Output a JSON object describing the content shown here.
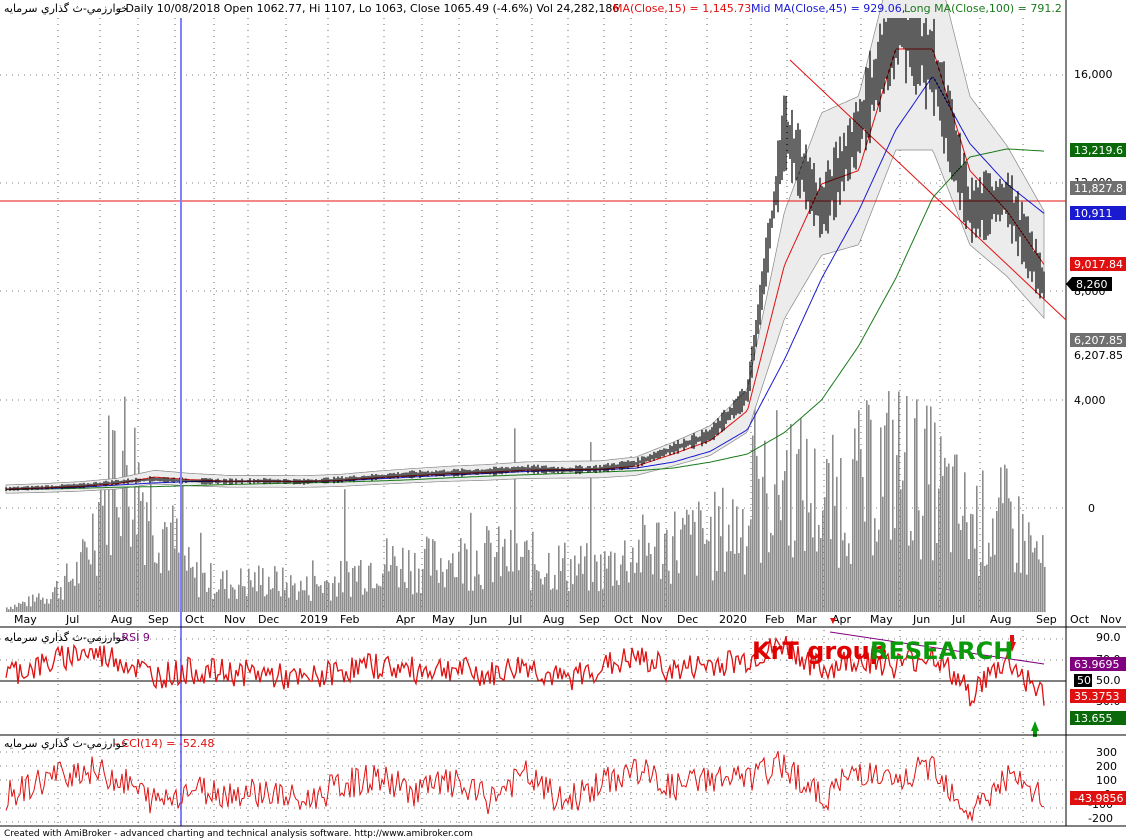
{
  "header": {
    "symbol": "خوارزمي-ث گذاري سرمايه",
    "info": " - Daily 10/08/2018 Open 1062.77, Hi 1107, Lo 1063, Close 1065.49 (-4.6%) Vol 24,282,186 ",
    "ma15": "MA(Close,15) = 1,145.73,",
    "ma45": " Mid MA(Close,45) = 929.06,",
    "ma100": " Long MA(Close,100) = 791.2"
  },
  "colors": {
    "price_bar": "#000000",
    "volume": "#8c8c8c",
    "ma15": "#e01010",
    "ma45": "#1a1ad0",
    "ma100": "#1a7a1a",
    "band_fill": "#ececec",
    "cursor": "#8080ff",
    "rsi": "#e01010",
    "cci": "#e01010",
    "trendline": "#e01010",
    "rsi_trend": "#800080"
  },
  "price_axis": {
    "ticks": [
      "16,000",
      "12,000",
      "8,000",
      "4,000",
      "0"
    ],
    "labels": [
      {
        "text": "13,219.6",
        "bg": "#0a6a0a",
        "fg": "#ffffff"
      },
      {
        "text": "11,827.8",
        "bg": "#707070",
        "fg": "#ffffff"
      },
      {
        "text": "10,911",
        "bg": "#1a1ad0",
        "fg": "#ffffff"
      },
      {
        "text": "9,017.84",
        "bg": "#e01010",
        "fg": "#ffffff"
      },
      {
        "text": "8,260",
        "bg": "#000000",
        "fg": "#ffffff"
      },
      {
        "text": "6,207.85",
        "bg": "#707070",
        "fg": "#ffffff"
      },
      {
        "text": "6,207.85",
        "bg": "#ffffff",
        "fg": "#000000"
      }
    ]
  },
  "x_axis": {
    "labels": [
      "May",
      "Jul",
      "Aug",
      "Sep",
      "Oct",
      "Nov",
      "Dec",
      "2019",
      "Feb",
      "Apr",
      "May",
      "Jun",
      "Jul",
      "Aug",
      "Sep",
      "Oct",
      "Nov",
      "Dec",
      "2020",
      "Feb",
      "Mar",
      "Apr",
      "May",
      "Jun",
      "Jul",
      "Aug",
      "Sep",
      "Oct",
      "Nov"
    ]
  },
  "rsi_panel": {
    "title_symbol": "خوارزمي-ث گذاري سرمايه",
    "title_ind": " - RSI 9",
    "ticks": [
      "90.0",
      "70.0",
      "50.0",
      "30.0"
    ],
    "labels": [
      {
        "text": "63.9695",
        "bg": "#800080",
        "fg": "#ffffff"
      },
      {
        "text": "50",
        "bg": "#000000",
        "fg": "#ffffff"
      },
      {
        "text": "35.3753",
        "bg": "#e01010",
        "fg": "#ffffff"
      },
      {
        "text": "13.655",
        "bg": "#0a6a0a",
        "fg": "#ffffff"
      }
    ]
  },
  "cci_panel": {
    "title_symbol": "خوارزمي-ث گذاري سرمايه",
    "title_ind": " - CCI(14) = -52.48",
    "ticks": [
      "300",
      "200",
      "100",
      "0",
      "-100",
      "-200"
    ],
    "labels": [
      {
        "text": "-43.9856",
        "bg": "#e01010",
        "fg": "#ffffff"
      }
    ]
  },
  "watermark": {
    "part1": "KrT group ",
    "part2": "RESEARCH"
  },
  "footer": "Created with AmiBroker - advanced charting and technical analysis software. http://www.amibroker.com",
  "chart_data": {
    "type": "line",
    "x": [
      "2018-05",
      "2018-07",
      "2018-08",
      "2018-09",
      "2018-10",
      "2018-11",
      "2018-12",
      "2019-01",
      "2019-02",
      "2019-04",
      "2019-05",
      "2019-06",
      "2019-07",
      "2019-08",
      "2019-09",
      "2019-10",
      "2019-11",
      "2019-12",
      "2020-01",
      "2020-02",
      "2020-03",
      "2020-04",
      "2020-05",
      "2020-06",
      "2020-07",
      "2020-08",
      "2020-09",
      "2020-10",
      "2020-11"
    ],
    "series": [
      {
        "name": "Close",
        "values": [
          700,
          760,
          820,
          950,
          1065,
          1000,
          980,
          1000,
          970,
          1050,
          1150,
          1250,
          1300,
          1350,
          1450,
          1400,
          1450,
          1650,
          2200,
          2700,
          4200,
          14000,
          11000,
          14000,
          18000,
          16500,
          11000,
          11500,
          8260
        ]
      },
      {
        "name": "MA(Close,15)",
        "values": [
          700,
          740,
          800,
          900,
          1145,
          1050,
          990,
          990,
          980,
          1020,
          1120,
          1200,
          1270,
          1320,
          1400,
          1420,
          1430,
          1550,
          2000,
          2500,
          3600,
          9000,
          12000,
          12500,
          17000,
          17000,
          12500,
          11000,
          9017.84
        ]
      },
      {
        "name": "Mid MA(Close,45)",
        "values": [
          690,
          720,
          770,
          850,
          929,
          980,
          990,
          990,
          985,
          1000,
          1080,
          1150,
          1220,
          1280,
          1350,
          1390,
          1410,
          1480,
          1700,
          2100,
          2900,
          5500,
          8500,
          11000,
          14000,
          16000,
          13500,
          12000,
          10911
        ]
      },
      {
        "name": "Long MA(Close,100)",
        "values": [
          680,
          700,
          730,
          770,
          791,
          830,
          870,
          900,
          930,
          960,
          1000,
          1050,
          1120,
          1180,
          1230,
          1280,
          1330,
          1380,
          1480,
          1700,
          2000,
          2800,
          4000,
          6000,
          8500,
          11500,
          13000,
          13300,
          13219.6
        ]
      },
      {
        "name": "RSI 9",
        "values": [
          58,
          65,
          78,
          72,
          55,
          60,
          58,
          57,
          50,
          60,
          65,
          60,
          63,
          55,
          66,
          50,
          63,
          72,
          60,
          66,
          70,
          85,
          60,
          72,
          65,
          76,
          38,
          70,
          35.3753
        ]
      },
      {
        "name": "CCI(14)",
        "values": [
          -20,
          100,
          180,
          120,
          -52.48,
          40,
          10,
          20,
          -60,
          60,
          120,
          20,
          80,
          -40,
          140,
          -60,
          60,
          180,
          40,
          120,
          100,
          220,
          -40,
          180,
          60,
          220,
          -140,
          120,
          -43.9856
        ]
      }
    ],
    "volume": [
      2,
      6,
      18,
      70,
      45,
      15,
      12,
      14,
      10,
      14,
      22,
      20,
      22,
      24,
      22,
      20,
      18,
      26,
      30,
      32,
      40,
      60,
      45,
      55,
      65,
      55,
      38,
      40,
      20
    ],
    "ylim": [
      0,
      20000
    ],
    "panels": {
      "rsi_ylim": [
        0,
        100
      ],
      "cci_ylim": [
        -250,
        350
      ],
      "rsi_midline": 50
    },
    "horizontal_line": 11827.8,
    "grid": true
  }
}
